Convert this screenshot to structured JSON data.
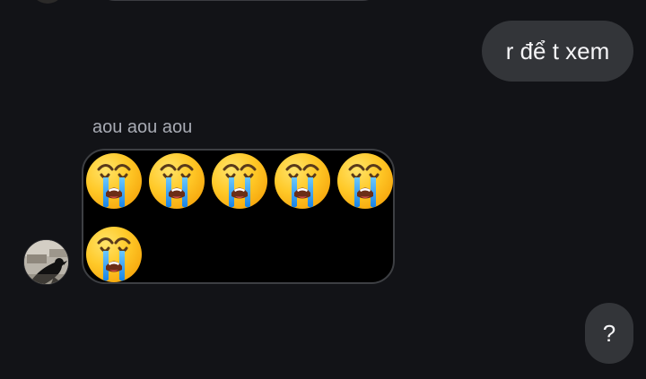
{
  "conversation": {
    "messages": [
      {
        "type": "outgoing",
        "text": "r để t xem"
      },
      {
        "type": "incoming",
        "sender": "aou aou aou",
        "emoji": "😭😭😭😭😭😭",
        "emoji_count": 6,
        "emoji_name": "loudly-crying-face"
      },
      {
        "type": "outgoing",
        "text": "?"
      }
    ]
  },
  "colors": {
    "background": "#121317",
    "outgoing_bubble": "#333539",
    "incoming_bubble": "#000000",
    "incoming_border": "#3d3f43",
    "sender_name": "#a8abb4",
    "text": "#f5f5f7"
  }
}
